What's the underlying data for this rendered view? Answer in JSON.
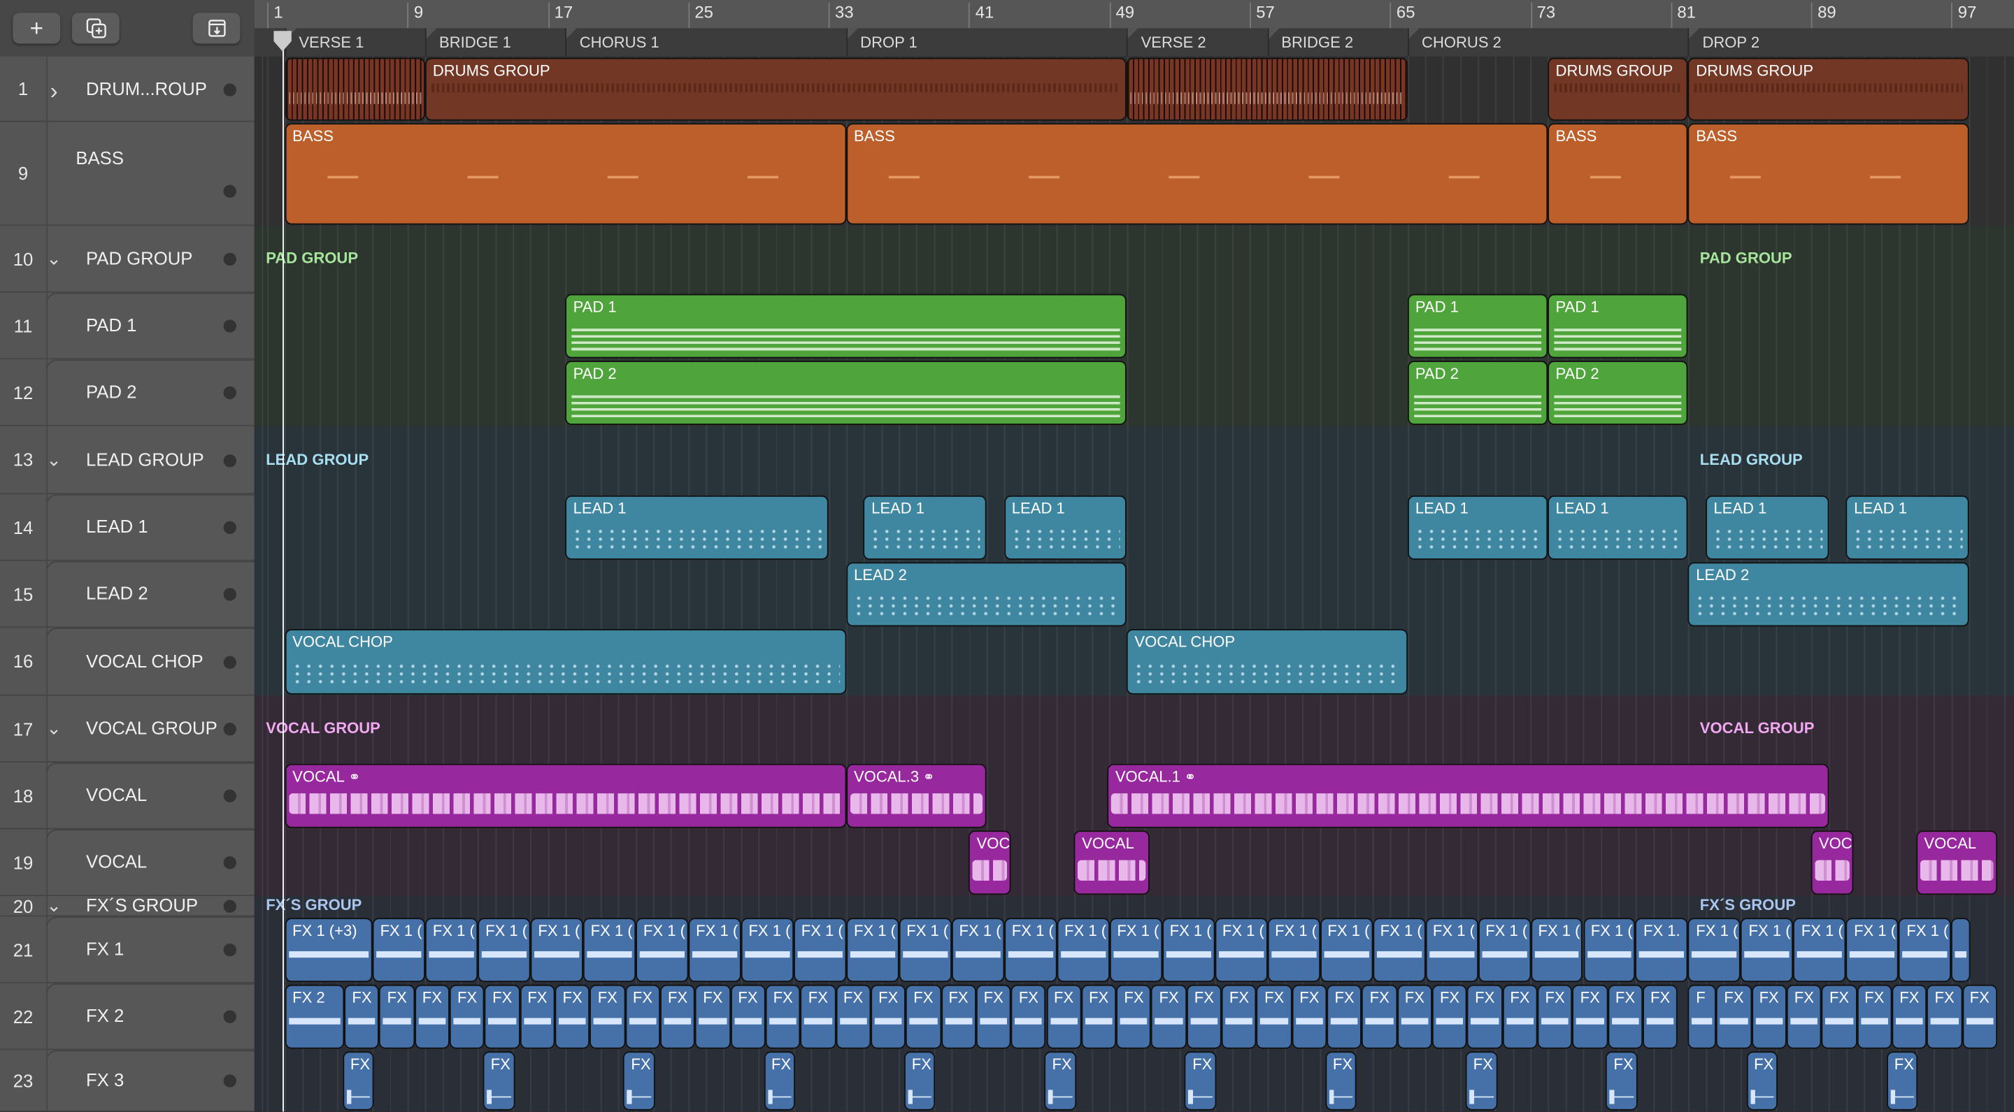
{
  "toolbar": {
    "add_icon": "plus-icon",
    "duplicate_icon": "duplicate-plus-icon",
    "import_icon": "download-tray-icon"
  },
  "ruler": {
    "bars": [
      "1",
      "9",
      "17",
      "25",
      "33",
      "41",
      "49",
      "57",
      "65",
      "73",
      "81",
      "89",
      "97"
    ]
  },
  "markers": [
    {
      "label": "VERSE 1",
      "bar": 2
    },
    {
      "label": "BRIDGE 1",
      "bar": 10
    },
    {
      "label": "CHORUS 1",
      "bar": 18
    },
    {
      "label": "DROP 1",
      "bar": 34
    },
    {
      "label": "VERSE 2",
      "bar": 50
    },
    {
      "label": "BRIDGE 2",
      "bar": 58
    },
    {
      "label": "CHORUS 2",
      "bar": 66
    },
    {
      "label": "DROP 2",
      "bar": 82
    }
  ],
  "tracks": [
    {
      "number": "1",
      "name": "DRUM...ROUP",
      "fold": "collapsed"
    },
    {
      "number": "9",
      "name": "BASS",
      "fold": "none"
    },
    {
      "number": "10",
      "name": "PAD GROUP",
      "fold": "expanded"
    },
    {
      "number": "11",
      "name": "PAD 1",
      "fold": "child"
    },
    {
      "number": "12",
      "name": "PAD 2",
      "fold": "child"
    },
    {
      "number": "13",
      "name": "LEAD GROUP",
      "fold": "expanded"
    },
    {
      "number": "14",
      "name": "LEAD 1",
      "fold": "child"
    },
    {
      "number": "15",
      "name": "LEAD 2",
      "fold": "child"
    },
    {
      "number": "16",
      "name": "VOCAL CHOP",
      "fold": "child"
    },
    {
      "number": "17",
      "name": "VOCAL GROUP",
      "fold": "expanded"
    },
    {
      "number": "18",
      "name": "VOCAL",
      "fold": "child"
    },
    {
      "number": "19",
      "name": "VOCAL",
      "fold": "child"
    },
    {
      "number": "20",
      "name": "FX´S GROUP",
      "fold": "expanded"
    },
    {
      "number": "21",
      "name": "FX 1",
      "fold": "child"
    },
    {
      "number": "22",
      "name": "FX 2",
      "fold": "child"
    },
    {
      "number": "23",
      "name": "FX 3",
      "fold": "child"
    }
  ],
  "group_labels": [
    {
      "track": 2,
      "text": "PAD GROUP",
      "color": "#a6e59c"
    },
    {
      "track": 5,
      "text": "LEAD GROUP",
      "color": "#a8dff0"
    },
    {
      "track": 9,
      "text": "VOCAL GROUP",
      "color": "#f2a8f0"
    },
    {
      "track": 12,
      "text": "FX´S GROUP",
      "color": "#a9c6f0"
    }
  ],
  "group_label_bars": [
    1,
    82
  ],
  "colors": {
    "drums": "#733725",
    "drums_pattern": "#7a3624",
    "bass": "#bd5f2a",
    "pad": "#4fa43c",
    "lead": "#3f86a0",
    "vocal": "#98289e",
    "fx": "#4571a8"
  },
  "regions": [
    {
      "track": 0,
      "type": "drums_pattern",
      "start": 2,
      "end": 10,
      "label": ""
    },
    {
      "track": 0,
      "type": "drums",
      "start": 10,
      "end": 50,
      "label": "DRUMS GROUP"
    },
    {
      "track": 0,
      "type": "drums_pattern",
      "start": 50,
      "end": 66,
      "label": ""
    },
    {
      "track": 0,
      "type": "drums",
      "start": 74,
      "end": 82,
      "label": "DRUMS GROUP"
    },
    {
      "track": 0,
      "type": "drums",
      "start": 82,
      "end": 98,
      "label": "DRUMS GROUP"
    },
    {
      "track": 1,
      "type": "bass",
      "start": 2,
      "end": 34,
      "label": "BASS"
    },
    {
      "track": 1,
      "type": "bass",
      "start": 34,
      "end": 74,
      "label": "BASS"
    },
    {
      "track": 1,
      "type": "bass",
      "start": 74,
      "end": 82,
      "label": "BASS"
    },
    {
      "track": 1,
      "type": "bass",
      "start": 82,
      "end": 98,
      "label": "BASS"
    },
    {
      "track": 3,
      "type": "pad",
      "start": 18,
      "end": 50,
      "label": "PAD 1"
    },
    {
      "track": 3,
      "type": "pad",
      "start": 66,
      "end": 74,
      "label": "PAD 1"
    },
    {
      "track": 3,
      "type": "pad",
      "start": 74,
      "end": 82,
      "label": "PAD 1"
    },
    {
      "track": 4,
      "type": "pad",
      "start": 18,
      "end": 50,
      "label": "PAD 2"
    },
    {
      "track": 4,
      "type": "pad",
      "start": 66,
      "end": 74,
      "label": "PAD 2"
    },
    {
      "track": 4,
      "type": "pad",
      "start": 74,
      "end": 82,
      "label": "PAD 2"
    },
    {
      "track": 6,
      "type": "lead",
      "start": 18,
      "end": 33,
      "label": "LEAD 1"
    },
    {
      "track": 6,
      "type": "lead",
      "start": 35,
      "end": 42,
      "label": "LEAD 1"
    },
    {
      "track": 6,
      "type": "lead",
      "start": 43,
      "end": 50,
      "label": "LEAD 1"
    },
    {
      "track": 6,
      "type": "lead",
      "start": 66,
      "end": 74,
      "label": "LEAD 1"
    },
    {
      "track": 6,
      "type": "lead",
      "start": 74,
      "end": 82,
      "label": "LEAD 1"
    },
    {
      "track": 6,
      "type": "lead",
      "start": 83,
      "end": 90,
      "label": "LEAD 1"
    },
    {
      "track": 6,
      "type": "lead",
      "start": 91,
      "end": 98,
      "label": "LEAD 1"
    },
    {
      "track": 7,
      "type": "lead",
      "start": 34,
      "end": 50,
      "label": "LEAD 2"
    },
    {
      "track": 7,
      "type": "lead",
      "start": 82,
      "end": 98,
      "label": "LEAD 2"
    },
    {
      "track": 8,
      "type": "lead",
      "start": 2,
      "end": 34,
      "label": "VOCAL CHOP"
    },
    {
      "track": 8,
      "type": "lead",
      "start": 50,
      "end": 66,
      "label": "VOCAL CHOP"
    },
    {
      "track": 10,
      "type": "vocal",
      "start": 2,
      "end": 34,
      "label": "VOCAL",
      "linked": true
    },
    {
      "track": 10,
      "type": "vocal",
      "start": 34,
      "end": 42,
      "label": "VOCAL.3",
      "linked": true
    },
    {
      "track": 10,
      "type": "vocal",
      "start": 48.9,
      "end": 90,
      "label": "VOCAL.1",
      "linked": true
    },
    {
      "track": 11,
      "type": "vocal",
      "start": 41,
      "end": 43.4,
      "label": "VOC"
    },
    {
      "track": 11,
      "type": "vocal",
      "start": 47,
      "end": 51.3,
      "label": "VOCAL"
    },
    {
      "track": 11,
      "type": "vocal",
      "start": 89,
      "end": 91.4,
      "label": "VOC"
    },
    {
      "track": 11,
      "type": "vocal",
      "start": 95,
      "end": 99.6,
      "label": "VOCAL"
    },
    {
      "track": 13,
      "type": "fx",
      "start": 2,
      "end": 7,
      "label": "FX 1 (+3)"
    },
    {
      "track": 14,
      "type": "fx",
      "start": 2,
      "end": 5.4,
      "label": "FX 2"
    }
  ],
  "region_runs": [
    {
      "track": 13,
      "type": "fx",
      "start": 7,
      "length": 3,
      "count": 24,
      "label": "FX 1 ("
    },
    {
      "track": 13,
      "type": "fx",
      "start": 79,
      "length": 3,
      "count": 1,
      "label": "FX 1."
    },
    {
      "track": 13,
      "type": "fx",
      "start": 82,
      "length": 3,
      "count": 5,
      "label": "FX 1 ("
    },
    {
      "track": 13,
      "type": "fx",
      "start": 97,
      "length": 1.1,
      "count": 1,
      "label": ""
    },
    {
      "track": 14,
      "type": "fx",
      "start": 5.4,
      "length": 2,
      "count": 38,
      "label": "FX"
    },
    {
      "track": 14,
      "type": "fx",
      "start": 82,
      "length": 1.6,
      "count": 1,
      "label": "F"
    },
    {
      "track": 14,
      "type": "fx",
      "start": 83.6,
      "length": 2,
      "count": 8,
      "label": "FX"
    },
    {
      "track": 15,
      "type": "fx",
      "start": 5.3,
      "length": 1.8,
      "count": 12,
      "step": 8,
      "label": "FX"
    }
  ]
}
